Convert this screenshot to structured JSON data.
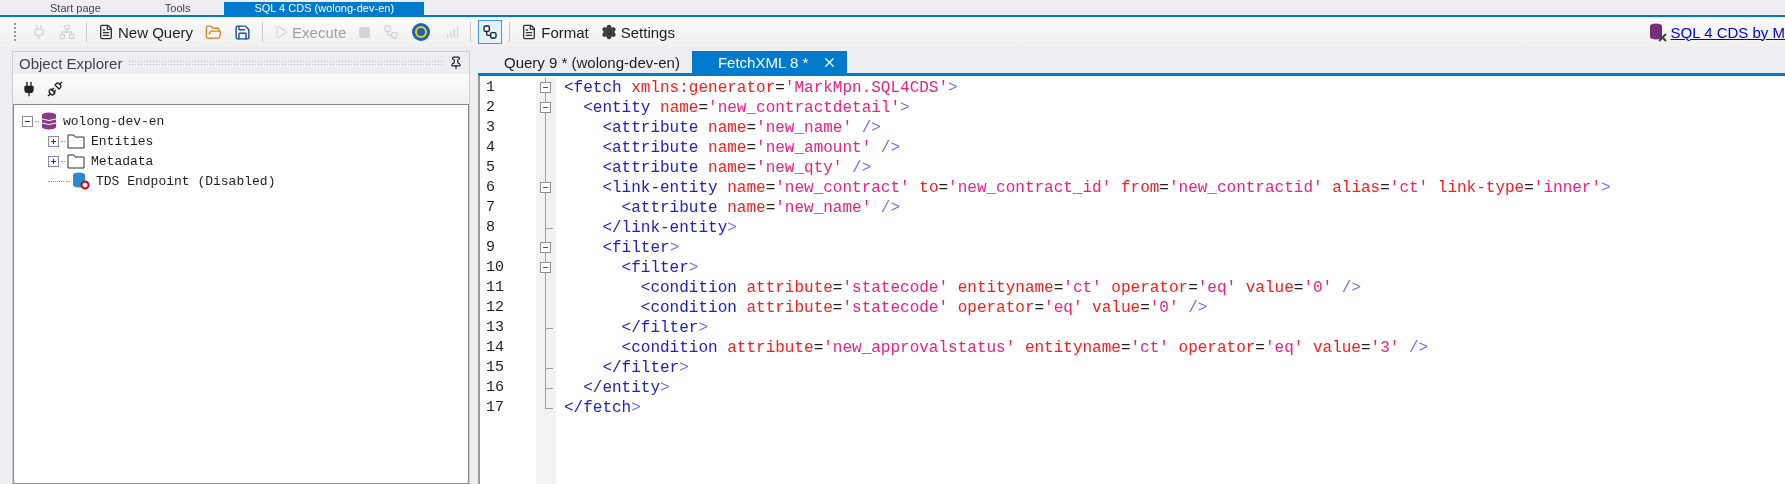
{
  "top_tabs": [
    {
      "label": "Start page",
      "selected": false
    },
    {
      "label": "Tools",
      "selected": false
    },
    {
      "label": "SQL 4 CDS (wolong-dev-en)",
      "selected": true
    }
  ],
  "toolbar": {
    "items": [
      {
        "kind": "button",
        "disabled": true
      },
      {
        "kind": "button",
        "disabled": true
      },
      {
        "kind": "separator"
      },
      {
        "kind": "button",
        "label": "New Query",
        "disabled": false
      },
      {
        "kind": "button",
        "disabled": false
      },
      {
        "kind": "button",
        "disabled": false
      },
      {
        "kind": "separator"
      },
      {
        "kind": "button",
        "label": "Execute",
        "disabled": true
      },
      {
        "kind": "button",
        "disabled": true
      },
      {
        "kind": "button",
        "disabled": true
      },
      {
        "kind": "button",
        "disabled": false
      },
      {
        "kind": "button",
        "disabled": true
      },
      {
        "kind": "separator"
      },
      {
        "kind": "toggle",
        "on": true
      },
      {
        "kind": "separator"
      },
      {
        "kind": "button",
        "label": "Format",
        "disabled": false
      },
      {
        "kind": "button",
        "label": "Settings",
        "disabled": false
      }
    ],
    "link": "SQL 4 CDS by M"
  },
  "object_explorer": {
    "title": "Object Explorer",
    "tree": [
      {
        "label": "wolong-dev-en",
        "kind": "database",
        "expanded": true,
        "children": [
          {
            "label": "Entities",
            "kind": "folder",
            "expanded": false
          },
          {
            "label": "Metadata",
            "kind": "folder",
            "expanded": false
          },
          {
            "label": "TDS Endpoint (Disabled)",
            "kind": "endpoint"
          }
        ]
      }
    ]
  },
  "document_tabs": [
    {
      "label": "Query 9 * (wolong-dev-en)",
      "selected": false,
      "closable": false
    },
    {
      "label": "FetchXML 8 *",
      "selected": true,
      "closable": true
    }
  ],
  "editor": {
    "lines": [
      {
        "number": "1",
        "kind": "open",
        "tokens": [
          {
            "kind": "tag",
            "text": "<fetch"
          },
          {
            "kind": "attr",
            "text": " xmlns:generator"
          },
          {
            "kind": "eq",
            "text": "="
          },
          {
            "kind": "value",
            "text": "'MarkMpn.SQL4CDS'"
          },
          {
            "kind": "punct",
            "text": ">"
          }
        ]
      },
      {
        "number": "2",
        "kind": "open",
        "tokens": [
          {
            "kind": "tag",
            "text": "  <entity"
          },
          {
            "kind": "attr",
            "text": " name"
          },
          {
            "kind": "eq",
            "text": "="
          },
          {
            "kind": "value",
            "text": "'new_contractdetail'"
          },
          {
            "kind": "punct",
            "text": ">"
          }
        ]
      },
      {
        "number": "3",
        "kind": "line",
        "tokens": [
          {
            "kind": "tag",
            "text": "    <attribute"
          },
          {
            "kind": "attr",
            "text": " name"
          },
          {
            "kind": "eq",
            "text": "="
          },
          {
            "kind": "value",
            "text": "'new_name'"
          },
          {
            "kind": "punct",
            "text": " />"
          }
        ]
      },
      {
        "number": "4",
        "kind": "line",
        "tokens": [
          {
            "kind": "tag",
            "text": "    <attribute"
          },
          {
            "kind": "attr",
            "text": " name"
          },
          {
            "kind": "eq",
            "text": "="
          },
          {
            "kind": "value",
            "text": "'new_amount'"
          },
          {
            "kind": "punct",
            "text": " />"
          }
        ]
      },
      {
        "number": "5",
        "kind": "line",
        "tokens": [
          {
            "kind": "tag",
            "text": "    <attribute"
          },
          {
            "kind": "attr",
            "text": " name"
          },
          {
            "kind": "eq",
            "text": "="
          },
          {
            "kind": "value",
            "text": "'new_qty'"
          },
          {
            "kind": "punct",
            "text": " />"
          }
        ]
      },
      {
        "number": "6",
        "kind": "open",
        "tokens": [
          {
            "kind": "tag",
            "text": "    <link-entity"
          },
          {
            "kind": "attr",
            "text": " name"
          },
          {
            "kind": "eq",
            "text": "="
          },
          {
            "kind": "value",
            "text": "'new_contract'"
          },
          {
            "kind": "attr",
            "text": " to"
          },
          {
            "kind": "eq",
            "text": "="
          },
          {
            "kind": "value",
            "text": "'new_contract_id'"
          },
          {
            "kind": "attr",
            "text": " from"
          },
          {
            "kind": "eq",
            "text": "="
          },
          {
            "kind": "value",
            "text": "'new_contractid'"
          },
          {
            "kind": "attr",
            "text": " alias"
          },
          {
            "kind": "eq",
            "text": "="
          },
          {
            "kind": "value",
            "text": "'ct'"
          },
          {
            "kind": "attr",
            "text": " link-type"
          },
          {
            "kind": "eq",
            "text": "="
          },
          {
            "kind": "value",
            "text": "'inner'"
          },
          {
            "kind": "punct",
            "text": ">"
          }
        ]
      },
      {
        "number": "7",
        "kind": "line",
        "tokens": [
          {
            "kind": "tag",
            "text": "      <attribute"
          },
          {
            "kind": "attr",
            "text": " name"
          },
          {
            "kind": "eq",
            "text": "="
          },
          {
            "kind": "value",
            "text": "'new_name'"
          },
          {
            "kind": "punct",
            "text": " />"
          }
        ]
      },
      {
        "number": "8",
        "kind": "end",
        "tokens": [
          {
            "kind": "tag",
            "text": "    </link-entity"
          },
          {
            "kind": "punct",
            "text": ">"
          }
        ]
      },
      {
        "number": "9",
        "kind": "open",
        "tokens": [
          {
            "kind": "tag",
            "text": "    <filter"
          },
          {
            "kind": "punct",
            "text": ">"
          }
        ]
      },
      {
        "number": "10",
        "kind": "open",
        "tokens": [
          {
            "kind": "tag",
            "text": "      <filter"
          },
          {
            "kind": "punct",
            "text": ">"
          }
        ]
      },
      {
        "number": "11",
        "kind": "line",
        "tokens": [
          {
            "kind": "tag",
            "text": "        <condition"
          },
          {
            "kind": "attr",
            "text": " attribute"
          },
          {
            "kind": "eq",
            "text": "="
          },
          {
            "kind": "value",
            "text": "'statecode'"
          },
          {
            "kind": "attr",
            "text": " entityname"
          },
          {
            "kind": "eq",
            "text": "="
          },
          {
            "kind": "value",
            "text": "'ct'"
          },
          {
            "kind": "attr",
            "text": " operator"
          },
          {
            "kind": "eq",
            "text": "="
          },
          {
            "kind": "value",
            "text": "'eq'"
          },
          {
            "kind": "attr",
            "text": " value"
          },
          {
            "kind": "eq",
            "text": "="
          },
          {
            "kind": "value",
            "text": "'0'"
          },
          {
            "kind": "punct",
            "text": " />"
          }
        ]
      },
      {
        "number": "12",
        "kind": "line",
        "tokens": [
          {
            "kind": "tag",
            "text": "        <condition"
          },
          {
            "kind": "attr",
            "text": " attribute"
          },
          {
            "kind": "eq",
            "text": "="
          },
          {
            "kind": "value",
            "text": "'statecode'"
          },
          {
            "kind": "attr",
            "text": " operator"
          },
          {
            "kind": "eq",
            "text": "="
          },
          {
            "kind": "value",
            "text": "'eq'"
          },
          {
            "kind": "attr",
            "text": " value"
          },
          {
            "kind": "eq",
            "text": "="
          },
          {
            "kind": "value",
            "text": "'0'"
          },
          {
            "kind": "punct",
            "text": " />"
          }
        ]
      },
      {
        "number": "13",
        "kind": "end",
        "tokens": [
          {
            "kind": "tag",
            "text": "      </filter"
          },
          {
            "kind": "punct",
            "text": ">"
          }
        ]
      },
      {
        "number": "14",
        "kind": "line",
        "tokens": [
          {
            "kind": "tag",
            "text": "      <condition"
          },
          {
            "kind": "attr",
            "text": " attribute"
          },
          {
            "kind": "eq",
            "text": "="
          },
          {
            "kind": "value",
            "text": "'new_approvalstatus'"
          },
          {
            "kind": "attr",
            "text": " entityname"
          },
          {
            "kind": "eq",
            "text": "="
          },
          {
            "kind": "value",
            "text": "'ct'"
          },
          {
            "kind": "attr",
            "text": " operator"
          },
          {
            "kind": "eq",
            "text": "="
          },
          {
            "kind": "value",
            "text": "'eq'"
          },
          {
            "kind": "attr",
            "text": " value"
          },
          {
            "kind": "eq",
            "text": "="
          },
          {
            "kind": "value",
            "text": "'3'"
          },
          {
            "kind": "punct",
            "text": " />"
          }
        ]
      },
      {
        "number": "15",
        "kind": "end",
        "tokens": [
          {
            "kind": "tag",
            "text": "    </filter"
          },
          {
            "kind": "punct",
            "text": ">"
          }
        ]
      },
      {
        "number": "16",
        "kind": "end",
        "tokens": [
          {
            "kind": "tag",
            "text": "  </entity"
          },
          {
            "kind": "punct",
            "text": ">"
          }
        ]
      },
      {
        "number": "17",
        "kind": "last",
        "tokens": [
          {
            "kind": "tag",
            "text": "</fetch"
          },
          {
            "kind": "punct",
            "text": ">"
          }
        ]
      }
    ]
  }
}
